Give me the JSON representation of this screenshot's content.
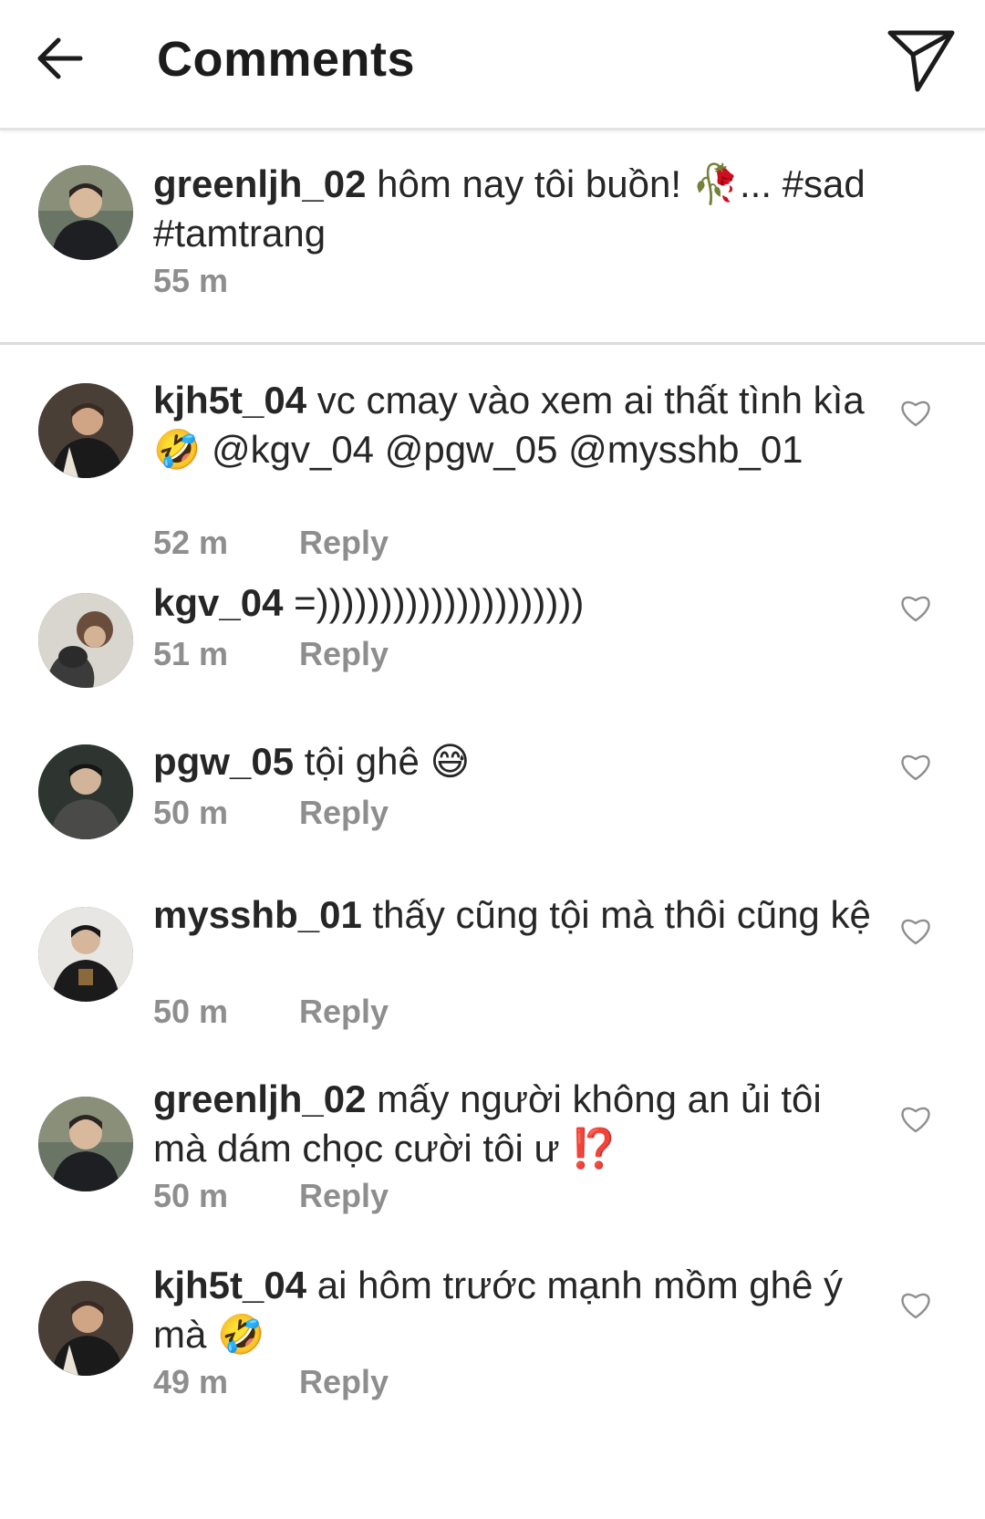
{
  "header": {
    "title": "Comments",
    "back_icon": "arrow-left-icon",
    "share_icon": "paper-plane-icon"
  },
  "caption": {
    "username": "greenljh_02",
    "text": "hôm nay tôi buồn! 🥀... #sad #tamtrang",
    "time": "55 m"
  },
  "comments": [
    {
      "username": "kjh5t_04",
      "text": "vc cmay vào xem ai thất tình kìa 🤣 @kgv_04 @pgw_05 @mysshb_01",
      "time": "52 m",
      "reply": "Reply"
    },
    {
      "username": "kgv_04",
      "text": "=)))))))))))))))))))))",
      "time": "51 m",
      "reply": "Reply"
    },
    {
      "username": "pgw_05",
      "text": "tội ghê 😅",
      "time": "50 m",
      "reply": "Reply"
    },
    {
      "username": "mysshb_01",
      "text": "thấy cũng tội mà thôi cũng kệ",
      "time": "50 m",
      "reply": "Reply"
    },
    {
      "username": "greenljh_02",
      "text": "mấy người không an ủi tôi mà dám chọc cười tôi ư ⁉️",
      "time": "50 m",
      "reply": "Reply"
    },
    {
      "username": "kjh5t_04",
      "text": "ai hôm trước mạnh mồm ghê ý mà 🤣",
      "time": "49 m",
      "reply": "Reply"
    }
  ],
  "colors": {
    "text": "#262626",
    "muted": "#8e8e8e",
    "divider": "#dcdcdc",
    "heart_outline": "#8e8e8e"
  }
}
